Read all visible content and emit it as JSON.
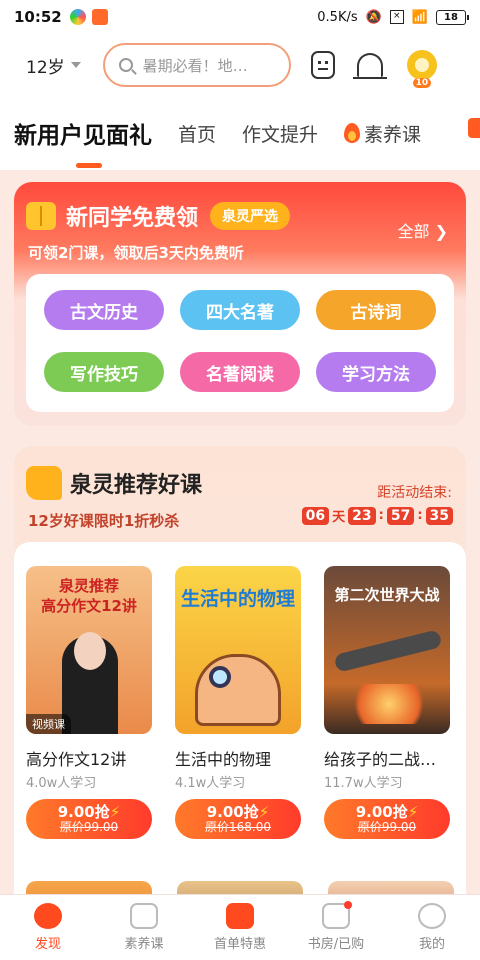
{
  "status": {
    "time": "10:52",
    "speed": "0.5K/s",
    "battery": "18"
  },
  "header": {
    "age": "12岁",
    "search_placeholder": "暑期必看！地…",
    "level": "10"
  },
  "tabs": [
    "新用户见面礼",
    "首页",
    "作文提升",
    "素养课"
  ],
  "free": {
    "title": "新同学免费领",
    "badge": "泉灵严选",
    "subtitle": "可领2门课，领取后3天内免费听",
    "all": "全部 ❯",
    "chips": [
      {
        "label": "古文历史",
        "color": "#b57cf0"
      },
      {
        "label": "四大名著",
        "color": "#5cc2f2"
      },
      {
        "label": "古诗词",
        "color": "#f5a52a"
      },
      {
        "label": "写作技巧",
        "color": "#7dcb55"
      },
      {
        "label": "名著阅读",
        "color": "#f56aa6"
      },
      {
        "label": "学习方法",
        "color": "#b57cf0"
      }
    ]
  },
  "rec": {
    "title": "泉灵推荐好课",
    "subtitle": "12岁好课限时1折秒杀",
    "countdown_label": "距活动结束:",
    "countdown": {
      "days": "06",
      "day_unit": "天",
      "h": "23",
      "m": "57",
      "s": "35"
    },
    "courses": [
      {
        "cover_text": "泉灵推荐\n高分作文12讲",
        "tag": "视频课",
        "name": "高分作文12讲",
        "stat": "4.0w人学习",
        "price": "9.00抢",
        "old": "原价99.00",
        "bg": "#f3a46a"
      },
      {
        "cover_text": "生活中的物理",
        "tag": "",
        "name": "生活中的物理",
        "stat": "4.1w人学习",
        "price": "9.00抢",
        "old": "原价168.00",
        "bg": "#f7c13a"
      },
      {
        "cover_text": "第二次世界大战",
        "tag": "",
        "name": "给孩子的二战…",
        "stat": "11.7w人学习",
        "price": "9.00抢",
        "old": "原价99.00",
        "bg": "#9b5a3a"
      }
    ]
  },
  "nav": [
    "发现",
    "素养课",
    "首单特惠",
    "书房/已购",
    "我的"
  ]
}
